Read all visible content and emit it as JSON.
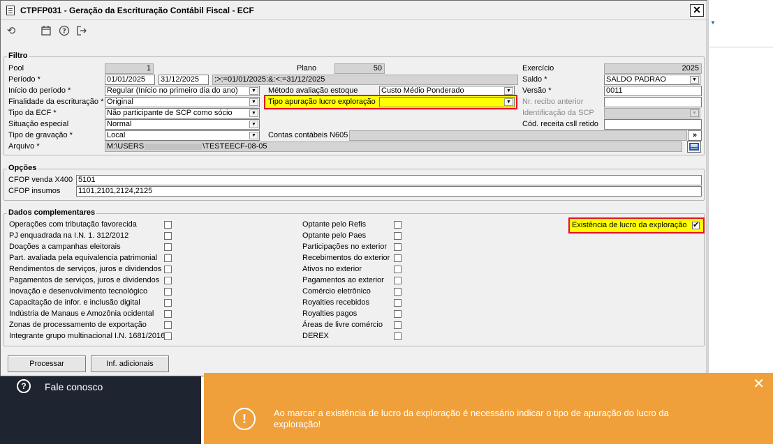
{
  "window": {
    "title": "CTPFP031 - Geração da Escrituração Contábil Fiscal - ECF",
    "close": "✕"
  },
  "toolbar": {
    "refresh_icon": "refresh-icon",
    "calendar_icon": "calendar-icon",
    "help_icon": "help-icon",
    "exit_icon": "exit-icon"
  },
  "filtro": {
    "legend": "Filtro",
    "pool_label": "Pool",
    "pool_value": "1",
    "plano_label": "Plano",
    "plano_value": "50",
    "exercicio_label": "Exercício",
    "exercicio_value": "2025",
    "periodo_label": "Período *",
    "periodo_start": "01/01/2025",
    "periodo_end": "31/12/2025",
    "periodo_expr": ":>:=01/01/2025:&:<:=31/12/2025",
    "saldo_label": "Saldo *",
    "saldo_value": "SALDO PADRAO",
    "inicio_label": "Início do período *",
    "inicio_value": "Regular (Início no primeiro dia do ano)",
    "metodo_label": "Método avaliação estoque",
    "metodo_value": "Custo Médio Ponderado",
    "versao_label": "Versão *",
    "versao_value": "0011",
    "finalidade_label": "Finalidade da escrituração *",
    "finalidade_value": "Original",
    "tipo_apuracao_label": "Tipo apuração lucro exploração",
    "tipo_apuracao_value": "",
    "nr_recibo_label": "Nr. recibo anterior",
    "nr_recibo_value": "",
    "tipo_ecf_label": "Tipo da ECF *",
    "tipo_ecf_value": "Não participante de SCP como sócio",
    "identificacao_label": "Identificação da SCP",
    "identificacao_value": "",
    "situacao_label": "Situação especial",
    "situacao_value": "Normal",
    "cod_receita_label": "Cód. receita csll retido",
    "cod_receita_value": "",
    "tipo_gravacao_label": "Tipo de gravação *",
    "tipo_gravacao_value": "Local",
    "contas_label": "Contas contábeis N605",
    "contas_value": "",
    "contas_btn": "»",
    "arquivo_label": "Arquivo *",
    "arquivo_prefix": "M:\\USERS",
    "arquivo_suffix": "\\TESTEECF-08-05"
  },
  "opcoes": {
    "legend": "Opções",
    "cfop_venda_label": "CFOP venda X400",
    "cfop_venda_value": "5101",
    "cfop_insumos_label": "CFOP insumos",
    "cfop_insumos_value": "1101,2101,2124,2125"
  },
  "dados": {
    "legend": "Dados complementares",
    "col1": [
      {
        "label": "Operações com tributação favorecida",
        "checked": false
      },
      {
        "label": "PJ enquadrada na I.N. 1. 312/2012",
        "checked": false
      },
      {
        "label": "Doações a campanhas eleitorais",
        "checked": false
      },
      {
        "label": "Part. avaliada pela equivalencia patrimonial",
        "checked": false
      },
      {
        "label": "Rendimentos de serviços, juros e dividendos",
        "checked": false
      },
      {
        "label": "Pagamentos de serviços, juros e dividendos",
        "checked": false
      },
      {
        "label": "Inovação e desenvolvimento tecnológico",
        "checked": false
      },
      {
        "label": "Capacitação de infor. e inclusão digital",
        "checked": false
      },
      {
        "label": "Indústria de Manaus e Amozônia ocidental",
        "checked": false
      },
      {
        "label": "Zonas de processamento de exportação",
        "checked": false
      },
      {
        "label": "Integrante grupo multinacional I.N. 1681/2016",
        "checked": false
      }
    ],
    "col2": [
      {
        "label": "Optante pelo Refis",
        "checked": false
      },
      {
        "label": "Optante pelo Paes",
        "checked": false
      },
      {
        "label": "Participações no exterior",
        "checked": false
      },
      {
        "label": "Recebimentos do exterior",
        "checked": false
      },
      {
        "label": "Ativos no exterior",
        "checked": false
      },
      {
        "label": "Pagamentos ao exterior",
        "checked": false
      },
      {
        "label": "Comércio eletrônico",
        "checked": false
      },
      {
        "label": "Royalties recebidos",
        "checked": false
      },
      {
        "label": "Royalties pagos",
        "checked": false
      },
      {
        "label": "Áreas de livre comércio",
        "checked": false
      },
      {
        "label": "DEREX",
        "checked": false
      }
    ],
    "existencia_label": "Existência de lucro da exploração",
    "existencia_checked": true
  },
  "buttons": {
    "processar": "Processar",
    "inf_adicionais": "Inf. adicionais"
  },
  "chat": {
    "icon": "?",
    "label": "Fale conosco"
  },
  "toast": {
    "icon": "!",
    "close": "✕",
    "message": "Ao marcar a existência de lucro da exploração é necessário indicar o tipo de apuração do lucro da exploração!"
  },
  "colors": {
    "toast": "#f0a03a",
    "highlight": "#e81123",
    "required_field": "#ffff00"
  }
}
